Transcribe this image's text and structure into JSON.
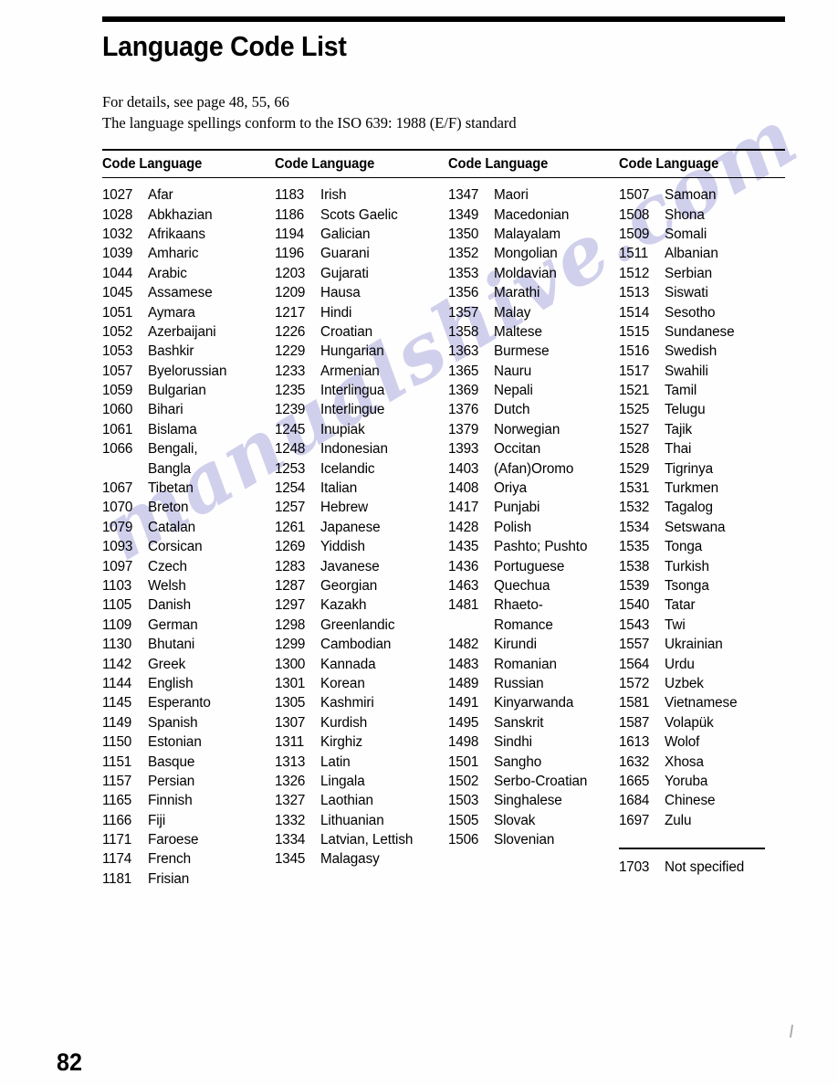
{
  "document": {
    "title": "Language Code List",
    "page_number": "82",
    "watermark": "manualshive.com"
  },
  "intro": {
    "line1": "For details, see page 48, 55, 66",
    "line2": "The language spellings conform to the ISO 639: 1988 (E/F) standard"
  },
  "table": {
    "headers": [
      "Code Language",
      "Code Language",
      "Code Language",
      "Code Language"
    ],
    "columns": [
      [
        {
          "code": "1027",
          "language": "Afar"
        },
        {
          "code": "1028",
          "language": "Abkhazian"
        },
        {
          "code": "1032",
          "language": "Afrikaans"
        },
        {
          "code": "1039",
          "language": "Amharic"
        },
        {
          "code": "1044",
          "language": "Arabic"
        },
        {
          "code": "1045",
          "language": "Assamese"
        },
        {
          "code": "1051",
          "language": "Aymara"
        },
        {
          "code": "1052",
          "language": "Azerbaijani"
        },
        {
          "code": "1053",
          "language": "Bashkir"
        },
        {
          "code": "1057",
          "language": "Byelorussian"
        },
        {
          "code": "1059",
          "language": "Bulgarian"
        },
        {
          "code": "1060",
          "language": "Bihari"
        },
        {
          "code": "1061",
          "language": "Bislama"
        },
        {
          "code": "1066",
          "language": "Bengali,"
        },
        {
          "code": "",
          "language": "Bangla",
          "continuation": true
        },
        {
          "code": "1067",
          "language": "Tibetan"
        },
        {
          "code": "1070",
          "language": "Breton"
        },
        {
          "code": "1079",
          "language": "Catalan"
        },
        {
          "code": "1093",
          "language": "Corsican"
        },
        {
          "code": "1097",
          "language": "Czech"
        },
        {
          "code": "1103",
          "language": "Welsh"
        },
        {
          "code": "1105",
          "language": "Danish"
        },
        {
          "code": "1109",
          "language": "German"
        },
        {
          "code": "1130",
          "language": "Bhutani"
        },
        {
          "code": "1142",
          "language": "Greek"
        },
        {
          "code": "1144",
          "language": "English"
        },
        {
          "code": "1145",
          "language": "Esperanto"
        },
        {
          "code": "1149",
          "language": "Spanish"
        },
        {
          "code": "1150",
          "language": "Estonian"
        },
        {
          "code": "1151",
          "language": "Basque"
        },
        {
          "code": "1157",
          "language": "Persian"
        },
        {
          "code": "1165",
          "language": "Finnish"
        },
        {
          "code": "1166",
          "language": "Fiji"
        },
        {
          "code": "1171",
          "language": "Faroese"
        },
        {
          "code": "1174",
          "language": "French"
        },
        {
          "code": "1181",
          "language": "Frisian"
        }
      ],
      [
        {
          "code": "1183",
          "language": "Irish"
        },
        {
          "code": "1186",
          "language": "Scots Gaelic"
        },
        {
          "code": "1194",
          "language": "Galician"
        },
        {
          "code": "1196",
          "language": "Guarani"
        },
        {
          "code": "1203",
          "language": "Gujarati"
        },
        {
          "code": "1209",
          "language": "Hausa"
        },
        {
          "code": "1217",
          "language": "Hindi"
        },
        {
          "code": "1226",
          "language": "Croatian"
        },
        {
          "code": "1229",
          "language": "Hungarian"
        },
        {
          "code": "1233",
          "language": "Armenian"
        },
        {
          "code": "1235",
          "language": "Interlingua"
        },
        {
          "code": "1239",
          "language": "Interlingue"
        },
        {
          "code": "1245",
          "language": "Inupiak"
        },
        {
          "code": "1248",
          "language": "Indonesian"
        },
        {
          "code": "1253",
          "language": "Icelandic"
        },
        {
          "code": "1254",
          "language": "Italian"
        },
        {
          "code": "1257",
          "language": "Hebrew"
        },
        {
          "code": "1261",
          "language": "Japanese"
        },
        {
          "code": "1269",
          "language": "Yiddish"
        },
        {
          "code": "1283",
          "language": "Javanese"
        },
        {
          "code": "1287",
          "language": "Georgian"
        },
        {
          "code": "1297",
          "language": "Kazakh"
        },
        {
          "code": "1298",
          "language": "Greenlandic"
        },
        {
          "code": "1299",
          "language": "Cambodian"
        },
        {
          "code": "1300",
          "language": "Kannada"
        },
        {
          "code": "1301",
          "language": "Korean"
        },
        {
          "code": "1305",
          "language": "Kashmiri"
        },
        {
          "code": "1307",
          "language": "Kurdish"
        },
        {
          "code": "1311",
          "language": "Kirghiz"
        },
        {
          "code": "1313",
          "language": "Latin"
        },
        {
          "code": "1326",
          "language": "Lingala"
        },
        {
          "code": "1327",
          "language": "Laothian"
        },
        {
          "code": "1332",
          "language": "Lithuanian"
        },
        {
          "code": "1334",
          "language": "Latvian, Lettish"
        },
        {
          "code": "1345",
          "language": "Malagasy"
        }
      ],
      [
        {
          "code": "1347",
          "language": "Maori"
        },
        {
          "code": "1349",
          "language": "Macedonian"
        },
        {
          "code": "1350",
          "language": "Malayalam"
        },
        {
          "code": "1352",
          "language": "Mongolian"
        },
        {
          "code": "1353",
          "language": "Moldavian"
        },
        {
          "code": "1356",
          "language": "Marathi"
        },
        {
          "code": "1357",
          "language": "Malay"
        },
        {
          "code": "1358",
          "language": "Maltese"
        },
        {
          "code": "1363",
          "language": "Burmese"
        },
        {
          "code": "1365",
          "language": "Nauru"
        },
        {
          "code": "1369",
          "language": "Nepali"
        },
        {
          "code": "1376",
          "language": "Dutch"
        },
        {
          "code": "1379",
          "language": "Norwegian"
        },
        {
          "code": "1393",
          "language": "Occitan"
        },
        {
          "code": "1403",
          "language": "(Afan)Oromo"
        },
        {
          "code": "1408",
          "language": "Oriya"
        },
        {
          "code": "1417",
          "language": "Punjabi"
        },
        {
          "code": "1428",
          "language": "Polish"
        },
        {
          "code": "1435",
          "language": "Pashto; Pushto"
        },
        {
          "code": "1436",
          "language": "Portuguese"
        },
        {
          "code": "1463",
          "language": "Quechua"
        },
        {
          "code": "1481",
          "language": "Rhaeto-"
        },
        {
          "code": "",
          "language": "Romance",
          "continuation": true
        },
        {
          "code": "1482",
          "language": "Kirundi"
        },
        {
          "code": "1483",
          "language": "Romanian"
        },
        {
          "code": "1489",
          "language": "Russian"
        },
        {
          "code": "1491",
          "language": "Kinyarwanda"
        },
        {
          "code": "1495",
          "language": "Sanskrit"
        },
        {
          "code": "1498",
          "language": "Sindhi"
        },
        {
          "code": "1501",
          "language": "Sangho"
        },
        {
          "code": "1502",
          "language": "Serbo-Croatian"
        },
        {
          "code": "1503",
          "language": "Singhalese"
        },
        {
          "code": "1505",
          "language": "Slovak"
        },
        {
          "code": "1506",
          "language": "Slovenian"
        }
      ],
      [
        {
          "code": "1507",
          "language": "Samoan"
        },
        {
          "code": "1508",
          "language": "Shona"
        },
        {
          "code": "1509",
          "language": "Somali"
        },
        {
          "code": "1511",
          "language": "Albanian"
        },
        {
          "code": "1512",
          "language": "Serbian"
        },
        {
          "code": "1513",
          "language": "Siswati"
        },
        {
          "code": "1514",
          "language": "Sesotho"
        },
        {
          "code": "1515",
          "language": "Sundanese"
        },
        {
          "code": "1516",
          "language": "Swedish"
        },
        {
          "code": "1517",
          "language": "Swahili"
        },
        {
          "code": "1521",
          "language": "Tamil"
        },
        {
          "code": "1525",
          "language": "Telugu"
        },
        {
          "code": "1527",
          "language": "Tajik"
        },
        {
          "code": "1528",
          "language": "Thai"
        },
        {
          "code": "1529",
          "language": "Tigrinya"
        },
        {
          "code": "1531",
          "language": "Turkmen"
        },
        {
          "code": "1532",
          "language": "Tagalog"
        },
        {
          "code": "1534",
          "language": "Setswana"
        },
        {
          "code": "1535",
          "language": "Tonga"
        },
        {
          "code": "1538",
          "language": "Turkish"
        },
        {
          "code": "1539",
          "language": "Tsonga"
        },
        {
          "code": "1540",
          "language": "Tatar"
        },
        {
          "code": "1543",
          "language": "Twi"
        },
        {
          "code": "1557",
          "language": "Ukrainian"
        },
        {
          "code": "1564",
          "language": "Urdu"
        },
        {
          "code": "1572",
          "language": "Uzbek"
        },
        {
          "code": "1581",
          "language": "Vietnamese"
        },
        {
          "code": "1587",
          "language": "Volapük"
        },
        {
          "code": "1613",
          "language": "Wolof"
        },
        {
          "code": "1632",
          "language": "Xhosa"
        },
        {
          "code": "1665",
          "language": "Yoruba"
        },
        {
          "code": "1684",
          "language": "Chinese"
        },
        {
          "code": "1697",
          "language": "Zulu"
        }
      ]
    ],
    "footer_entry": {
      "code": "1703",
      "language": "Not specified"
    }
  }
}
